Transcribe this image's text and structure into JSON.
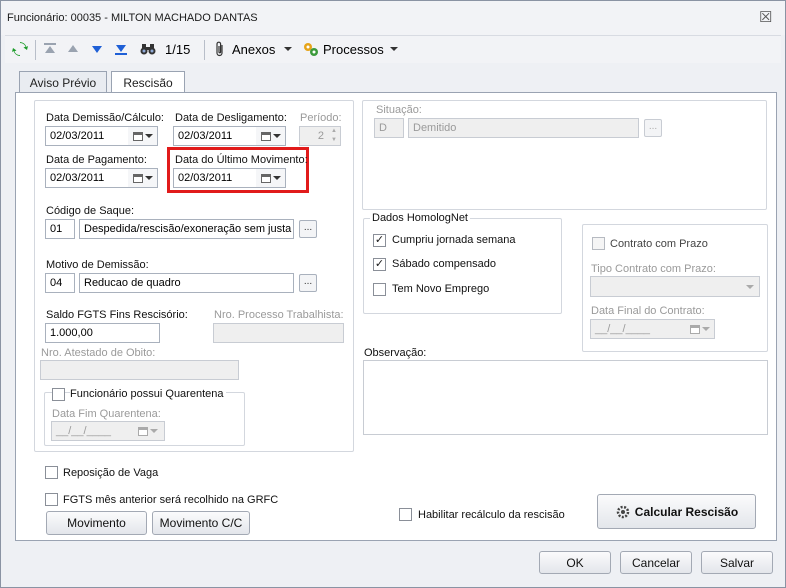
{
  "window": {
    "title": "Funcionário: 00035 - MILTON MACHADO DANTAS",
    "close_glyph": "☒"
  },
  "toolbar": {
    "record_position": "1/15",
    "attachments_label": "Anexos",
    "processes_label": "Processos"
  },
  "tabs": [
    {
      "label": "Aviso Prévio",
      "active": false
    },
    {
      "label": "Rescisão",
      "active": true
    }
  ],
  "left": {
    "data_demissao_label": "Data Demissão/Cálculo:",
    "data_demissao_value": "02/03/2011",
    "data_desligamento_label": "Data de Desligamento:",
    "data_desligamento_value": "02/03/2011",
    "periodo_label": "Período:",
    "periodo_value": "2",
    "data_pagamento_label": "Data de Pagamento:",
    "data_pagamento_value": "02/03/2011",
    "data_ultimo_mov_label": "Data do Último Movimento:",
    "data_ultimo_mov_value": "02/03/2011",
    "codigo_saque_label": "Código de Saque:",
    "codigo_saque_code": "01",
    "codigo_saque_desc": "Despedida/rescisão/exoneração sem justa c",
    "motivo_label": "Motivo de Demissão:",
    "motivo_code": "04",
    "motivo_desc": "Reducao de quadro",
    "saldo_fgts_label": "Saldo FGTS Fins Rescisório:",
    "saldo_fgts_value": "1.000,00",
    "nro_processo_label": "Nro. Processo Trabalhista:",
    "nro_processo_value": "",
    "nro_atestado_label": "Nro. Atestado de Obito:",
    "nro_atestado_value": "",
    "quarentena_label": "Funcionário possui Quarentena",
    "data_fim_quarentena_label": "Data Fim Quarentena:",
    "data_fim_quarentena_value": "__/__/____"
  },
  "right": {
    "situacao_label": "Situação:",
    "situacao_code": "D",
    "situacao_desc": "Demitido",
    "homolognet_title": "Dados HomologNet",
    "cumpriu_label": "Cumpriu jornada semana",
    "cumpriu_checked": true,
    "sabado_label": "Sábado compensado",
    "sabado_checked": true,
    "novo_emprego_label": "Tem Novo Emprego",
    "novo_emprego_checked": false,
    "contrato_prazo_label": "Contrato com Prazo",
    "tipo_contrato_label": "Tipo Contrato com Prazo:",
    "data_final_contrato_label": "Data Final do Contrato:",
    "data_final_contrato_value": "__/__/____",
    "observacao_label": "Observação:",
    "observacao_value": ""
  },
  "bottom": {
    "reposicao_label": "Reposição de Vaga",
    "fgts_anterior_label": "FGTS mês anterior será recolhido na GRFC",
    "movimento_button": "Movimento",
    "movimento_cc_button": "Movimento C/C",
    "habilitar_recalculo_label": "Habilitar recálculo da rescisão",
    "calcular_button": "Calcular Rescisão"
  },
  "footer": {
    "ok_button": "OK",
    "cancel_button": "Cancelar",
    "save_button": "Salvar"
  },
  "colors": {
    "highlight": "#e11b1b",
    "panel_bg": "#ffffff",
    "window_bg": "#eef0f4"
  }
}
